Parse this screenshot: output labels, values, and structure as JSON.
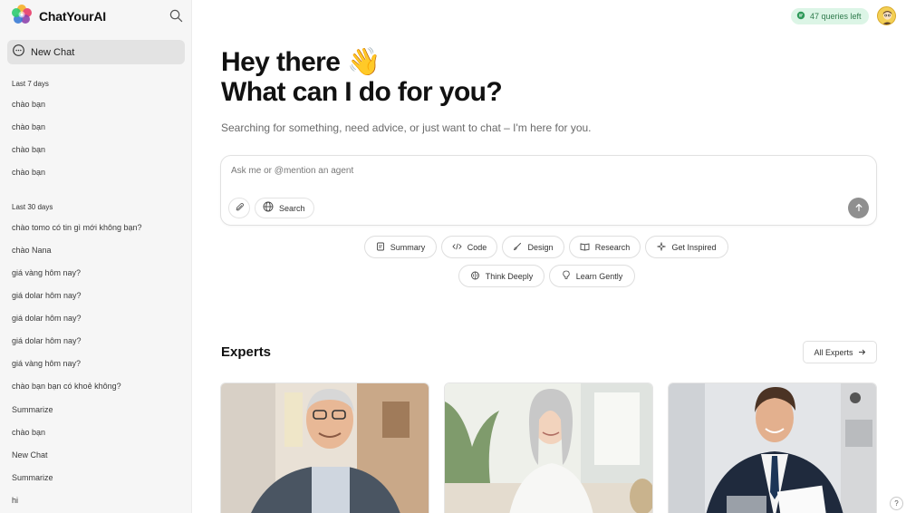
{
  "app": {
    "name": "ChatYourAI"
  },
  "sidebar": {
    "new_chat_label": "New Chat",
    "sections": [
      {
        "label": "Last 7 days",
        "items": [
          "chào bạn",
          "chào bạn",
          "chào bạn",
          "chào bạn"
        ]
      },
      {
        "label": "Last 30 days",
        "items": [
          "chào tomo có tin gì mới không bạn?",
          "chào Nana",
          "giá vàng hôm nay?",
          "giá dolar hôm nay?",
          "giá dolar hôm nay?",
          "giá dolar hôm nay?",
          "giá vàng hôm nay?",
          "chào bạn bạn có khoẻ không?",
          "Summarize",
          "chào bạn",
          "New Chat",
          "Summarize",
          "hi"
        ]
      }
    ]
  },
  "header": {
    "quota_text": "47 queries left"
  },
  "hero": {
    "title_line1": "Hey there 👋",
    "title_line2": "What can I do for you?",
    "subtitle": "Searching for something, need advice, or just want to chat – I'm here for you."
  },
  "composer": {
    "placeholder": "Ask me or @mention an agent",
    "value": "",
    "search_label": "Search"
  },
  "chips": {
    "summary": "Summary",
    "code": "Code",
    "design": "Design",
    "research": "Research",
    "get_inspired": "Get Inspired",
    "think_deeply": "Think Deeply",
    "learn_gently": "Learn Gently"
  },
  "experts": {
    "title": "Experts",
    "all_label": "All Experts"
  },
  "help_label": "?",
  "colors": {
    "accent_green": "#2f7a4c",
    "quota_bg": "#dcf5e6",
    "sidebar_bg": "#f6f6f6"
  }
}
